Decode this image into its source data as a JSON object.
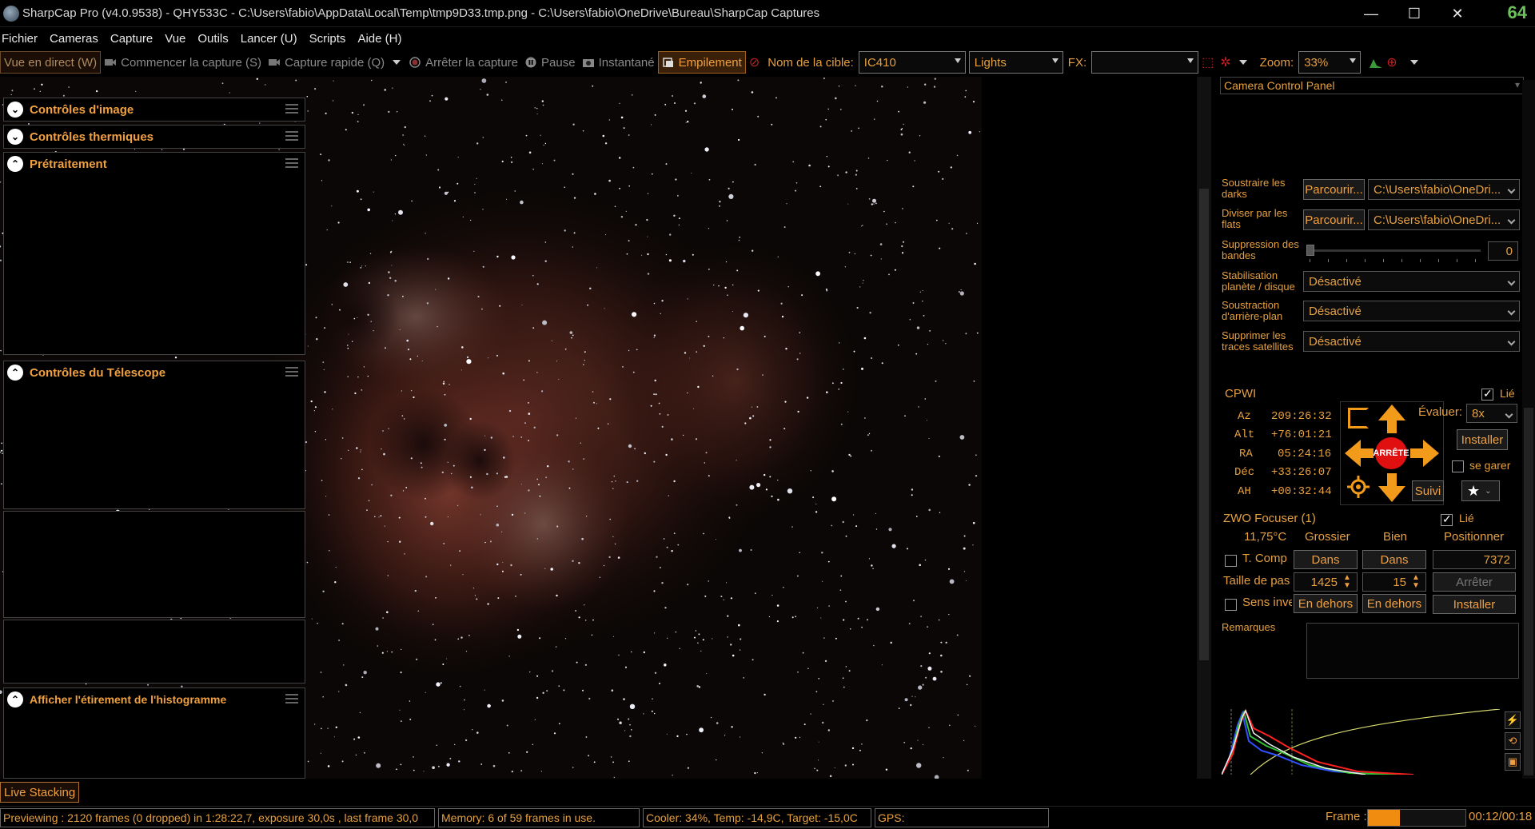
{
  "app": {
    "title": "SharpCap Pro (v4.0.9538) - QHY533C - C:\\Users\\fabio\\AppData\\Local\\Temp\\tmp9D33.tmp.png - C:\\Users\\fabio\\OneDrive\\Bureau\\SharpCap Captures",
    "badge": "64",
    "min_glyph": "—",
    "max_glyph": "☐",
    "close_glyph": "✕"
  },
  "menu": [
    "Fichier",
    "Cameras",
    "Capture",
    "Vue",
    "Outils",
    "Lancer (U)",
    "Scripts",
    "Aide (H)"
  ],
  "toolbar": {
    "live_view": "Vue en direct (W)",
    "start_capture": "Commencer la capture (S)",
    "quick_capture": "Capture rapide (Q)",
    "stop_capture": "Arrêter la capture",
    "pause": "Pause",
    "snapshot": "Instantané",
    "stacking": "Empilement",
    "target_label": "Nom de la cible:",
    "target_value": "IC410",
    "frame_type": "Lights",
    "fx_label": "FX:",
    "fx_value": "",
    "zoom_label": "Zoom:",
    "zoom_value": "33%"
  },
  "panel": {
    "header": "Camera Control Panel",
    "image_controls": "Contrôles d'image",
    "thermal_controls": "Contrôles thermiques",
    "preprocessing": {
      "title": "Prétraitement",
      "darks_label": "Soustraire les darks",
      "browse1": "Parcourir...",
      "darks_path": "C:\\Users\\fabio\\OneDri...",
      "flats_label": "Diviser par les flats",
      "browse2": "Parcourir...",
      "flats_path": "C:\\Users\\fabio\\OneDri...",
      "banding_label": "Suppression des bandes",
      "banding_value": "0",
      "stab_label": "Stabilisation planète / disque",
      "stab_value": "Désactivé",
      "bg_label": "Soustraction d'arrière-plan",
      "bg_value": "Désactivé",
      "sat_label": "Supprimer les traces satellites",
      "sat_value": "Désactivé"
    },
    "telescope": {
      "title": "Contrôles du Télescope",
      "mount": "CPWI",
      "linked": "Lié",
      "rows": [
        {
          "label": "Az",
          "value": "209:26:32"
        },
        {
          "label": "Alt",
          "value": "+76:01:21"
        },
        {
          "label": "RA",
          "value": "05:24:16"
        },
        {
          "label": "Déc",
          "value": "+33:26:07"
        },
        {
          "label": "AH",
          "value": "+00:32:44"
        }
      ],
      "rate_label": "Évaluer:",
      "rate_value": "8x",
      "install": "Installer",
      "park": "se garer",
      "stop": "ARRÊTE",
      "track": "Suivi"
    },
    "focuser": {
      "title": "ZWO Focuser (1)",
      "linked": "Lié",
      "temp": "11,75°C",
      "coarse": "Grossier",
      "fine": "Bien",
      "position": "Positionner",
      "tcomp": "T. Comp",
      "in1": "Dans",
      "in2": "Dans",
      "pos_value": "7372",
      "step_label": "Taille de pas",
      "step1": "1425",
      "step2": "15",
      "stop": "Arrêter",
      "reverse": "Sens inve",
      "out1": "En dehors",
      "out2": "En dehors",
      "install": "Installer"
    },
    "notes_label": "Remarques",
    "histogram": "Afficher l'étirement de l'histogramme"
  },
  "live_tab": "Live Stacking",
  "status": {
    "preview": "Previewing : 2120 frames (0 dropped) in 1:28:22,7, exposure 30,0s , last frame 30,0",
    "memory": "Memory: 6 of 59 frames in use.",
    "cooler": "Cooler: 34%, Temp: -14,9C, Target: -15,0C",
    "gps": "GPS:",
    "frame_label": "Frame :",
    "frame_progress": 0.33,
    "frame_time": "00:12/00:18"
  },
  "colors": {
    "accent": "#f0a040",
    "stop": "#e01010",
    "arrow": "#f29a1a"
  }
}
